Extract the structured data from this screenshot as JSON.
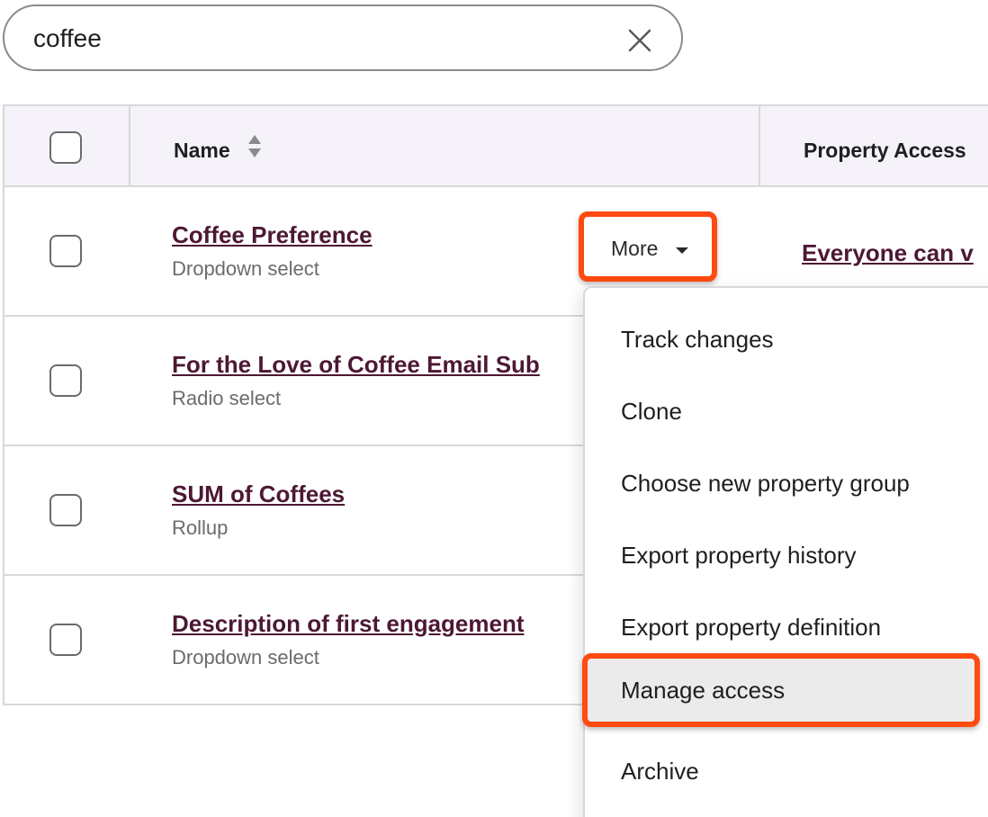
{
  "search": {
    "value": "coffee",
    "clear_icon": "close-icon"
  },
  "table": {
    "headers": {
      "name": "Name",
      "access": "Property Access"
    },
    "rows": [
      {
        "name": "Coffee Preference",
        "type": "Dropdown select",
        "access": "Everyone can v"
      },
      {
        "name": "For the Love of Coffee Email Sub",
        "type": "Radio select"
      },
      {
        "name": "SUM of Coffees",
        "type": "Rollup"
      },
      {
        "name": "Description of first engagement",
        "type": "Dropdown select"
      }
    ]
  },
  "more_button": {
    "label": "More",
    "icon": "caret-down-icon"
  },
  "menu": {
    "items": [
      {
        "label": "Track changes"
      },
      {
        "label": "Clone"
      },
      {
        "label": "Choose new property group"
      },
      {
        "label": "Export property history"
      },
      {
        "label": "Export property definition"
      },
      {
        "label": "Manage access"
      },
      {
        "label": "Archive"
      }
    ],
    "highlighted": "Manage access"
  },
  "colors": {
    "link": "#4d1834",
    "highlight_border": "#ff4a10",
    "header_bg": "#f5f2fa",
    "border": "#d8d8d8"
  }
}
